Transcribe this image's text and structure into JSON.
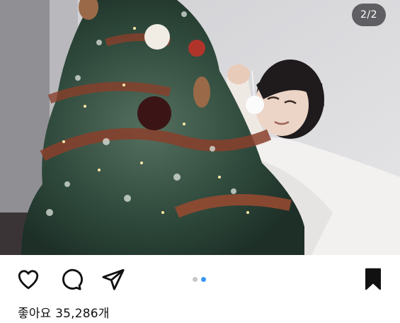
{
  "post": {
    "page_indicator": "2/2",
    "carousel": {
      "total": 2,
      "active_index": 1
    },
    "image_description": "photo-christmas-tree-woman",
    "liked": false,
    "saved": true
  },
  "actions": {
    "like_icon": "heart-outline-icon",
    "comment_icon": "comment-bubble-icon",
    "share_icon": "paper-plane-icon",
    "save_icon": "bookmark-filled-icon"
  },
  "likes": {
    "text": "좋아요 35,286개"
  },
  "colors": {
    "indicator_bg": "#3c3c40",
    "dot_active": "#3897f0",
    "dot_inactive": "#c8c8c8",
    "icon": "#111111"
  }
}
